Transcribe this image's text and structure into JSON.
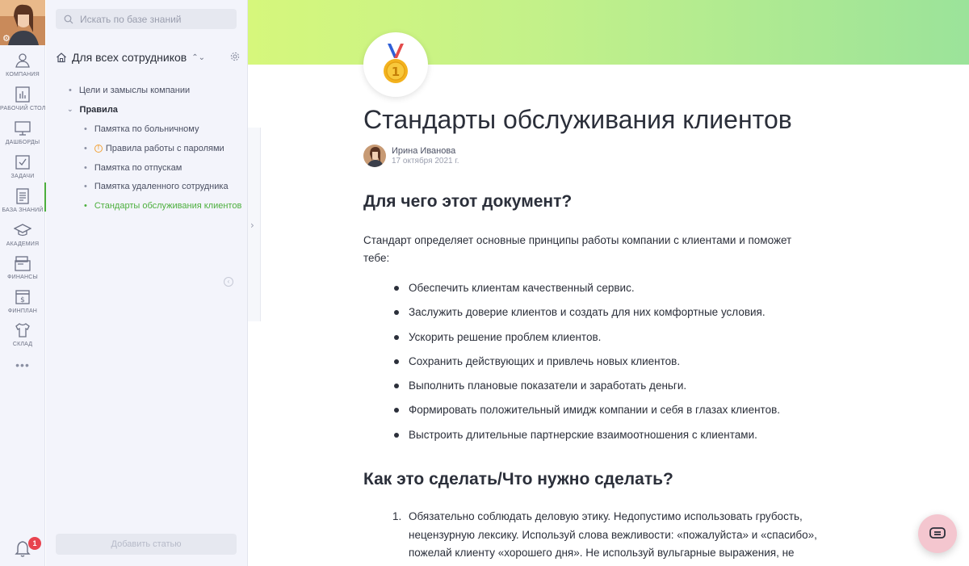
{
  "rail": {
    "items": [
      {
        "label": "КОМПАНИЯ",
        "icon": "company-icon"
      },
      {
        "label": "РАБОЧИЙ СТОЛ",
        "icon": "desktop-chart-icon"
      },
      {
        "label": "ДАШБОРДЫ",
        "icon": "monitor-icon"
      },
      {
        "label": "ЗАДАЧИ",
        "icon": "checkbox-icon"
      },
      {
        "label": "БАЗА ЗНАНИЙ",
        "icon": "document-icon"
      },
      {
        "label": "АКАДЕМИЯ",
        "icon": "graduation-cap-icon"
      },
      {
        "label": "ФИНАНСЫ",
        "icon": "wallet-icon"
      },
      {
        "label": "ФИНПЛАН",
        "icon": "dollar-box-icon"
      },
      {
        "label": "СКЛАД",
        "icon": "tshirt-icon"
      }
    ],
    "more": "•••",
    "notifications_count": "1"
  },
  "kb": {
    "search_placeholder": "Искать по базе знаний",
    "title": "Для всех сотрудников",
    "tree": {
      "item_goals": "Цели и замыслы компании",
      "folder_rules": "Правила",
      "item_sick": "Памятка по больничному",
      "item_passwords": "Правила работы с паролями",
      "item_vacation": "Памятка по отпускам",
      "item_remote": "Памятка удаленного сотрудника",
      "item_standards": "Стандарты обслуживания клиентов"
    },
    "add_button": "Добавить статью"
  },
  "doc": {
    "title": "Стандарты обслуживания клиентов",
    "author": "Ирина Иванова",
    "date": "17 октября 2021 г.",
    "section1": "Для чего этот документ?",
    "intro": "Стандарт определяет основные принципы работы компании с клиентами и поможет тебе:",
    "bullets": [
      "Обеспечить клиентам качественный сервис.",
      "Заслужить доверие клиентов и создать для них комфортные условия.",
      "Ускорить решение проблем клиентов.",
      "Сохранить действующих и привлечь новых клиентов.",
      "Выполнить плановые показатели и заработать деньги.",
      "Формировать положительный имидж компании и себя  в глазах клиентов.",
      "Выстроить длительные партнерские взаимоотношения с клиентами."
    ],
    "section2": "Как это сделать/Что нужно сделать?",
    "step1_num": "1.",
    "step1": "Обязательно соблюдать деловую этику. Недопустимо использовать грубость, нецензурную лексику. Используй слова вежливости: «пожалуйста» и «спасибо», пожелай клиенту «хорошего дня». Не используй вульгарные выражения, не"
  },
  "colors": {
    "accent": "#4caf3d",
    "sidebar_bg": "#f3f4fb",
    "banner_from": "#d6f77c",
    "banner_to": "#9be39a",
    "badge": "#e8434f",
    "chat_button": "#f4c6cf"
  }
}
